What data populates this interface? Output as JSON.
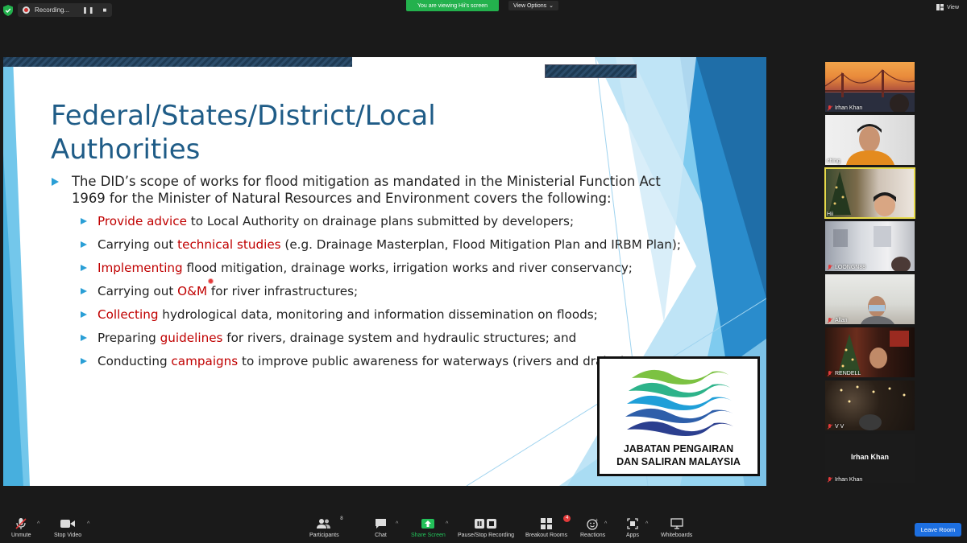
{
  "topbar": {
    "recording_label": "Recording...",
    "viewing_banner": "You are viewing Hii's screen",
    "view_options": "View Options",
    "view_label": "View"
  },
  "slide": {
    "title": "Federal/States/District/Local Authorities",
    "main_bullet": "The DID’s scope of works for flood mitigation as mandated in the Ministerial Function Act 1969 for the Minister of Natural Resources and Environment covers the following:",
    "sub_items": [
      {
        "pre": "",
        "em": "Provide advice",
        "post": " to Local Authority on drainage plans submitted by developers;"
      },
      {
        "pre": "Carrying out ",
        "em": "technical studies",
        "post": " (e.g. Drainage Masterplan, Flood Mitigation Plan and IRBM Plan);"
      },
      {
        "pre": "",
        "em": "Implementing",
        "post": " flood mitigation, drainage works, irrigation works and river conservancy;"
      },
      {
        "pre": "Carrying out ",
        "em": "O&M",
        "post": " for river infrastructures;"
      },
      {
        "pre": "",
        "em": "Collecting",
        "post": " hydrological data, monitoring and information dissemination on floods;"
      },
      {
        "pre": "Preparing ",
        "em": "guidelines",
        "post": " for rivers, drainage system and hydraulic structures; and"
      },
      {
        "pre": "Conducting ",
        "em": "campaigns",
        "post": " to improve public awareness for waterways (rivers and drains)"
      }
    ],
    "logo_line1": "JABATAN PENGAIRAN",
    "logo_line2": "DAN SALIRAN MALAYSIA",
    "accent_color": "#2a9fd6",
    "title_color": "#1f5c87",
    "emphasis_color": "#c00000"
  },
  "participants": [
    {
      "name": "Irhan Khan",
      "muted": true
    },
    {
      "name": "ching",
      "muted": false
    },
    {
      "name": "Hii",
      "muted": false,
      "active": true
    },
    {
      "name": "LOONGN88",
      "muted": true
    },
    {
      "name": "Allan",
      "muted": true
    },
    {
      "name": "RENDELL",
      "muted": true
    },
    {
      "name": "V V",
      "muted": true
    },
    {
      "name": "Irhan Khan",
      "muted": true,
      "center_label": "Irhan Khan"
    }
  ],
  "toolbar": {
    "unmute": "Unmute",
    "stop_video": "Stop Video",
    "participants": "Participants",
    "participants_count": "8",
    "chat": "Chat",
    "share_screen": "Share Screen",
    "pause_recording": "Pause/Stop Recording",
    "breakout_rooms": "Breakout Rooms",
    "breakout_badge": "4",
    "reactions": "Reactions",
    "apps": "Apps",
    "whiteboards": "Whiteboards",
    "leave_room": "Leave Room"
  }
}
